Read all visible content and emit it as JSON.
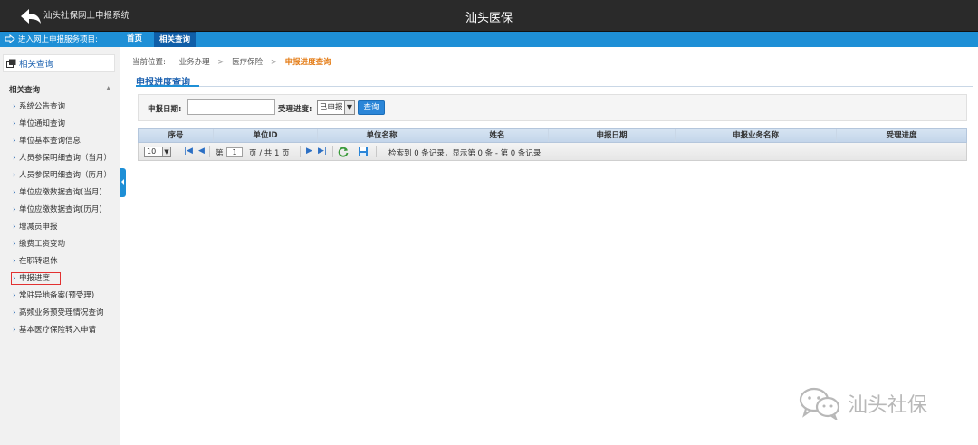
{
  "header": {
    "app_name": "汕头社保网上申报系统",
    "title": "汕头医保"
  },
  "nav": {
    "enter_label": "进入网上申报服务项目:",
    "tabs": [
      {
        "label": "首页"
      },
      {
        "label": "相关查询"
      }
    ]
  },
  "sidebar": {
    "heading": "相关查询",
    "group": "相关查询",
    "items": [
      {
        "label": "系统公告查询"
      },
      {
        "label": "单位通知查询"
      },
      {
        "label": "单位基本查询信息"
      },
      {
        "label": "人员参保明细查询（当月）"
      },
      {
        "label": "人员参保明细查询（历月）"
      },
      {
        "label": "单位应缴数据查询(当月)"
      },
      {
        "label": "单位应缴数据查询(历月)"
      },
      {
        "label": "增减员申报"
      },
      {
        "label": "缴费工资变动"
      },
      {
        "label": "在职转退休"
      },
      {
        "label": "申报进度"
      },
      {
        "label": "常驻异地备案(预受理)"
      },
      {
        "label": "高频业务预受理情况查询"
      },
      {
        "label": "基本医疗保险转入申请"
      }
    ]
  },
  "breadcrumb": {
    "prefix": "当前位置:",
    "level1": "业务办理",
    "level2": "医疗保险",
    "current": "申报进度查询"
  },
  "section": {
    "title": "申报进度查询"
  },
  "filter": {
    "date_label": "申报日期:",
    "date_value": "",
    "progress_label": "受理进度:",
    "progress_value": "已申报",
    "query_button": "查询"
  },
  "grid": {
    "columns": [
      {
        "label": "序号"
      },
      {
        "label": "单位ID"
      },
      {
        "label": "单位名称"
      },
      {
        "label": "姓名"
      },
      {
        "label": "申报日期"
      },
      {
        "label": "申报业务名称"
      },
      {
        "label": "受理进度"
      }
    ]
  },
  "pager": {
    "page_size": "10",
    "page_prefix": "第",
    "page_value": "1",
    "page_suffix": "页 / 共 1 页",
    "status": "检索到 0 条记录，显示第 0 条 - 第 0 条记录"
  },
  "watermark": {
    "text": "汕头社保"
  },
  "colors": {
    "nav_blue": "#1e8fd6",
    "highlight_red": "#e23131",
    "breadcrumb_orange": "#e47b14"
  }
}
